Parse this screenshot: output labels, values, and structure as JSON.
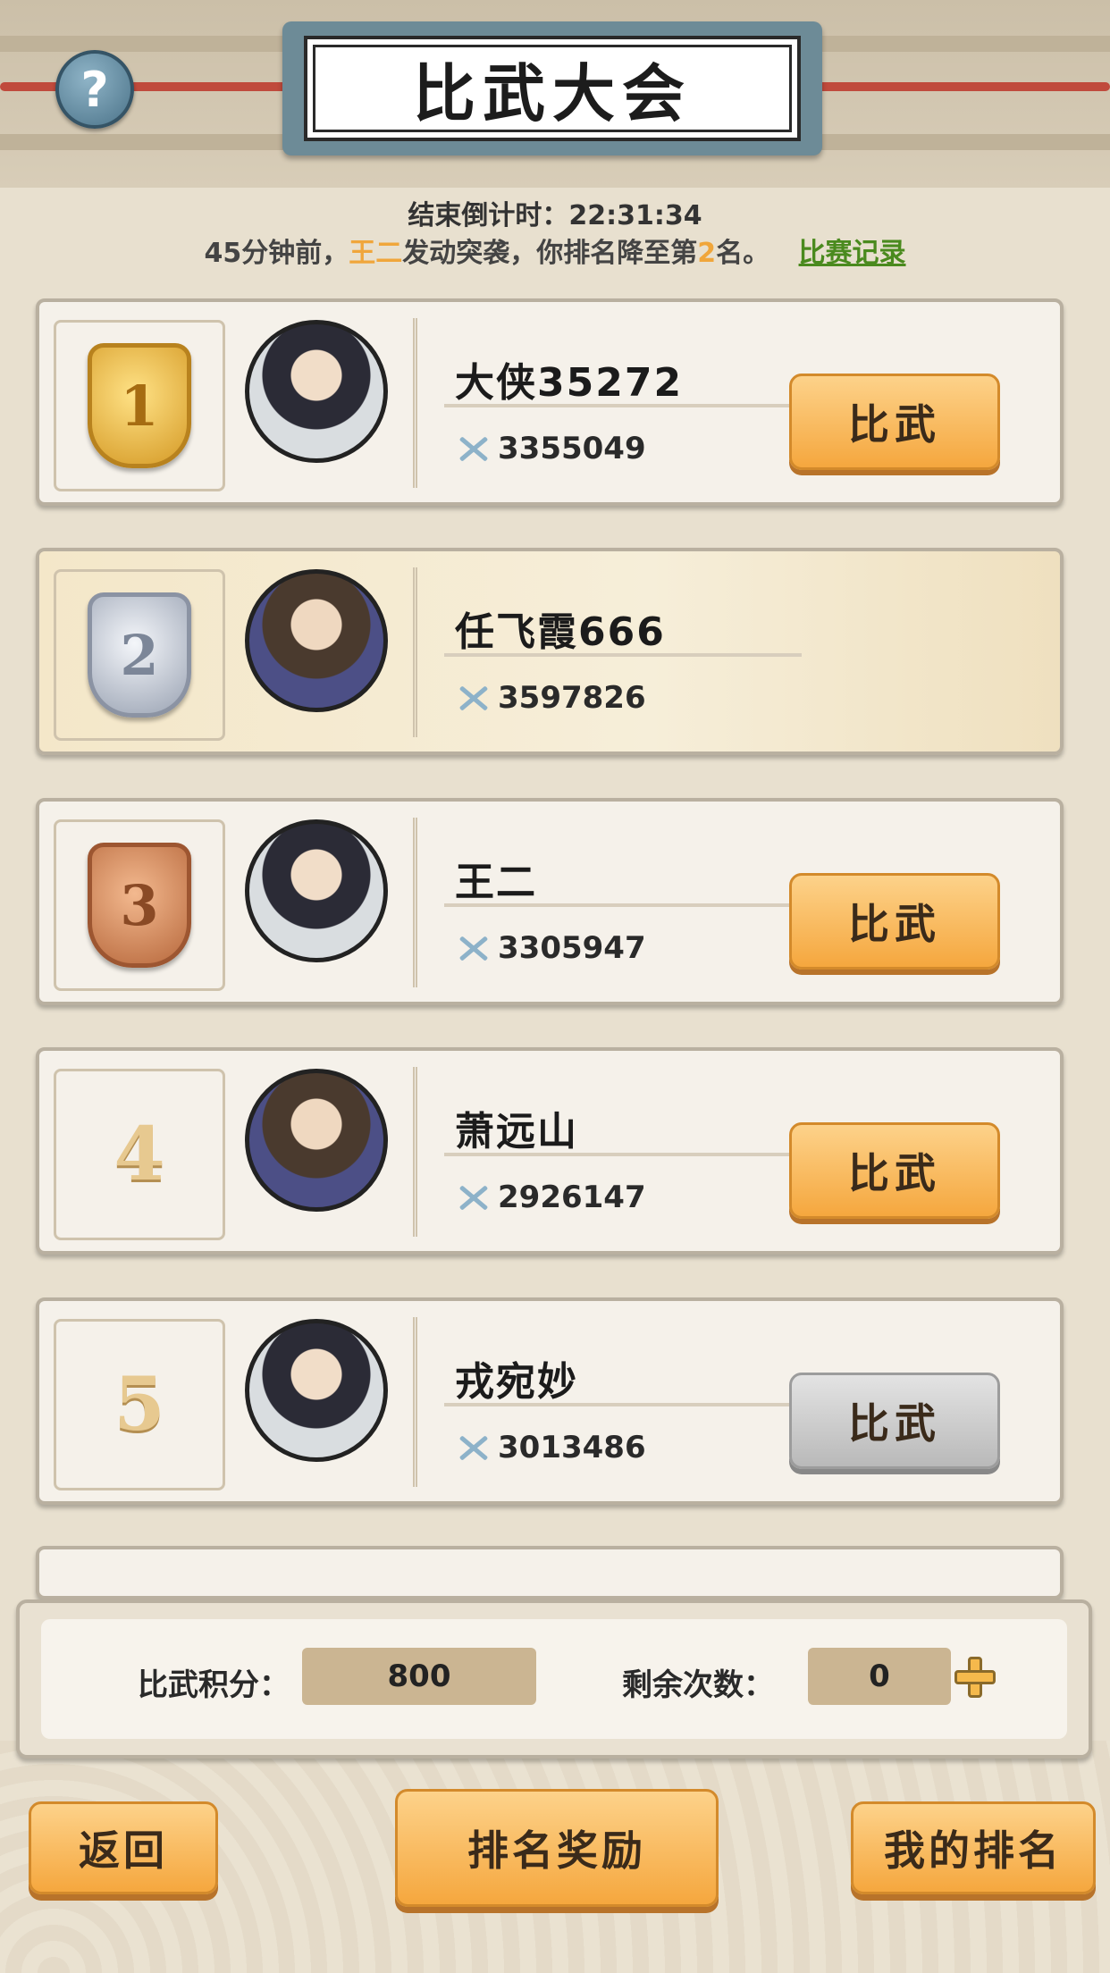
{
  "header": {
    "help_icon": "question-icon",
    "help_glyph": "?",
    "title": "比武大会",
    "countdown": "结束倒计时：22:31:34",
    "notice_prefix": "45分钟前，",
    "notice_attacker": "王二",
    "notice_middle": "发动突袭，你排名降至第",
    "notice_rank": "2",
    "notice_suffix": "名。",
    "record_link": "比赛记录"
  },
  "players": [
    {
      "rank": "1",
      "name": "大侠35272",
      "power": "3355049",
      "button": "比武"
    },
    {
      "rank": "2",
      "name": "任飞霞666",
      "power": "3597826"
    },
    {
      "rank": "3",
      "name": "王二",
      "power": "3305947",
      "button": "比武"
    },
    {
      "rank": "4",
      "name": "萧远山",
      "power": "2926147",
      "button": "比武"
    },
    {
      "rank": "5",
      "name": "戎宛妙",
      "power": "3013486",
      "button": "比武"
    }
  ],
  "score_panel": {
    "score_label": "比武积分：",
    "score_value": "800",
    "remaining_label": "剩余次数：",
    "remaining_value": "0",
    "add_icon": "plus-icon"
  },
  "footer": {
    "back_label": "返回",
    "rewards_label": "排名奖励",
    "my_rank_label": "我的排名"
  },
  "colors": {
    "accent_button": "#f5a73e",
    "highlight_name": "#f0a63b",
    "link": "#4a8a1e",
    "disabled_button": "#b9b9b9"
  }
}
